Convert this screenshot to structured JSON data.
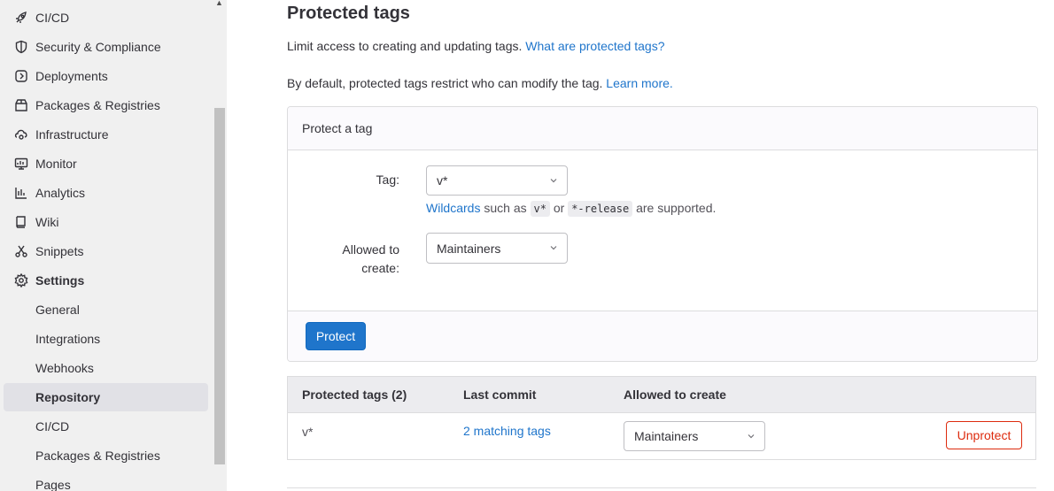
{
  "sidebar": {
    "items": [
      {
        "label": "CI/CD",
        "icon": "rocket-icon"
      },
      {
        "label": "Security & Compliance",
        "icon": "shield-icon"
      },
      {
        "label": "Deployments",
        "icon": "deployments-icon"
      },
      {
        "label": "Packages & Registries",
        "icon": "package-icon"
      },
      {
        "label": "Infrastructure",
        "icon": "cloud-gear-icon"
      },
      {
        "label": "Monitor",
        "icon": "monitor-icon"
      },
      {
        "label": "Analytics",
        "icon": "chart-icon"
      },
      {
        "label": "Wiki",
        "icon": "book-icon"
      },
      {
        "label": "Snippets",
        "icon": "scissors-icon"
      },
      {
        "label": "Settings",
        "icon": "gear-icon"
      }
    ],
    "subitems": [
      {
        "label": "General"
      },
      {
        "label": "Integrations"
      },
      {
        "label": "Webhooks"
      },
      {
        "label": "Repository"
      },
      {
        "label": "CI/CD"
      },
      {
        "label": "Packages & Registries"
      },
      {
        "label": "Pages"
      }
    ],
    "active_subitem": "Repository"
  },
  "main": {
    "title": "Protected tags",
    "description": "Limit access to creating and updating tags.",
    "description_link": "What are protected tags?",
    "default_text": "By default, protected tags restrict who can modify the tag.",
    "default_link": "Learn more.",
    "form": {
      "header": "Protect a tag",
      "tag_label": "Tag:",
      "tag_value": "v*",
      "hint_link": "Wildcards",
      "hint_text_1": "such as",
      "hint_code_1": "v*",
      "hint_text_2": "or",
      "hint_code_2": "*-release",
      "hint_text_3": "are supported.",
      "allowed_label_1": "Allowed to",
      "allowed_label_2": "create:",
      "allowed_value": "Maintainers",
      "submit_label": "Protect"
    },
    "table": {
      "headers": [
        "Protected tags (2)",
        "Last commit",
        "Allowed to create"
      ],
      "rows": [
        {
          "tag": "v*",
          "commit": "2 matching tags",
          "allowed": "Maintainers",
          "action": "Unprotect"
        }
      ]
    }
  },
  "colors": {
    "link": "#1f75cb",
    "primary": "#1f75cb",
    "danger": "#dd2b0e"
  }
}
